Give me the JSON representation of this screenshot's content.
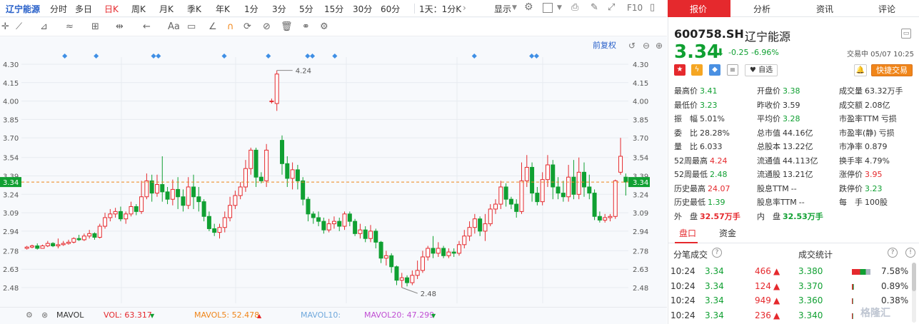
{
  "period_bar": {
    "stock": "辽宁能源",
    "items": [
      "分时",
      "多日",
      "日K",
      "周K",
      "月K",
      "季K",
      "年K",
      "1分",
      "3分",
      "5分",
      "15分",
      "30分",
      "60分",
      "1天：1分K"
    ],
    "active": "日K",
    "display": "显示",
    "f10": "F10"
  },
  "draw_bar": {
    "text_tool": "Aa",
    "fq": "前复权"
  },
  "chart": {
    "price_labels": [
      "4.30",
      "4.15",
      "4.00",
      "3.85",
      "3.70",
      "3.54",
      "3.39",
      "3.24",
      "3.09",
      "2.94",
      "2.78",
      "2.63",
      "2.48"
    ],
    "price_values": [
      4.3,
      4.15,
      4.0,
      3.85,
      3.7,
      3.54,
      3.39,
      3.24,
      3.09,
      2.94,
      2.78,
      2.63,
      2.48
    ],
    "current_label": "3.34",
    "current_value": 3.34,
    "high_label": "4.24",
    "low_label": "2.48",
    "up_color": "#e5292d",
    "down_color": "#10a032",
    "candles": [
      [
        2.8,
        2.81,
        2.79,
        2.82
      ],
      [
        2.81,
        2.82,
        2.8,
        2.83
      ],
      [
        2.82,
        2.8,
        2.79,
        2.84
      ],
      [
        2.8,
        2.82,
        2.8,
        2.83
      ],
      [
        2.82,
        2.84,
        2.81,
        2.86
      ],
      [
        2.84,
        2.82,
        2.81,
        2.85
      ],
      [
        2.82,
        2.83,
        2.8,
        2.88
      ],
      [
        2.83,
        2.84,
        2.82,
        2.86
      ],
      [
        2.84,
        2.85,
        2.83,
        2.87
      ],
      [
        2.85,
        2.88,
        2.84,
        2.89
      ],
      [
        2.88,
        2.87,
        2.86,
        2.91
      ],
      [
        2.87,
        2.9,
        2.86,
        2.92
      ],
      [
        2.9,
        2.92,
        2.88,
        2.95
      ],
      [
        2.92,
        2.89,
        2.87,
        2.93
      ],
      [
        2.89,
        2.98,
        2.88,
        3.0
      ],
      [
        2.98,
        3.05,
        2.96,
        3.09
      ],
      [
        3.05,
        3.08,
        3.02,
        3.12
      ],
      [
        3.08,
        3.1,
        3.05,
        3.13
      ],
      [
        3.1,
        3.04,
        3.02,
        3.14
      ],
      [
        3.04,
        3.08,
        3.0,
        3.1
      ],
      [
        3.08,
        3.14,
        3.06,
        3.18
      ],
      [
        3.14,
        3.1,
        3.07,
        3.16
      ],
      [
        3.1,
        3.22,
        3.08,
        3.35
      ],
      [
        3.22,
        3.35,
        3.2,
        3.41
      ],
      [
        3.35,
        3.25,
        3.18,
        3.4
      ],
      [
        3.25,
        3.32,
        3.22,
        3.4
      ],
      [
        3.32,
        3.26,
        3.18,
        3.55
      ],
      [
        3.26,
        3.2,
        3.16,
        3.3
      ],
      [
        3.2,
        3.28,
        3.15,
        3.36
      ],
      [
        3.28,
        3.22,
        3.12,
        3.38
      ],
      [
        3.22,
        3.15,
        3.1,
        3.28
      ],
      [
        3.15,
        3.3,
        3.12,
        3.38
      ],
      [
        3.3,
        3.22,
        3.12,
        3.4
      ],
      [
        3.22,
        3.18,
        3.1,
        3.3
      ],
      [
        3.18,
        3.06,
        3.02,
        3.2
      ],
      [
        3.06,
        2.96,
        2.94,
        3.1
      ],
      [
        2.96,
        2.93,
        2.9,
        3.0
      ],
      [
        2.93,
        2.97,
        2.88,
        3.0
      ],
      [
        2.97,
        3.05,
        2.93,
        3.1
      ],
      [
        3.05,
        3.15,
        3.02,
        3.22
      ],
      [
        3.15,
        3.23,
        3.12,
        3.27
      ],
      [
        3.23,
        3.3,
        3.2,
        3.34
      ],
      [
        3.3,
        3.45,
        3.26,
        3.52
      ],
      [
        3.45,
        3.6,
        3.4,
        3.62
      ],
      [
        3.6,
        3.38,
        3.3,
        3.62
      ],
      [
        3.38,
        3.35,
        3.33,
        3.42
      ],
      [
        3.35,
        3.6,
        3.3,
        3.65
      ],
      [
        4.0,
        4.0,
        3.98,
        4.02
      ],
      [
        3.98,
        4.22,
        3.92,
        4.25
      ],
      [
        3.68,
        3.49,
        3.4,
        3.72
      ],
      [
        3.49,
        3.37,
        3.3,
        3.55
      ],
      [
        3.37,
        3.44,
        3.28,
        3.5
      ],
      [
        3.44,
        3.35,
        3.28,
        3.48
      ],
      [
        3.35,
        3.2,
        3.15,
        3.38
      ],
      [
        3.2,
        3.08,
        3.02,
        3.22
      ],
      [
        3.08,
        3.05,
        3.0,
        3.1
      ],
      [
        3.05,
        3.02,
        2.98,
        3.1
      ],
      [
        3.02,
        2.95,
        2.92,
        3.05
      ],
      [
        2.95,
        3.0,
        2.93,
        3.04
      ],
      [
        3.0,
        3.02,
        2.96,
        3.06
      ],
      [
        3.02,
        2.98,
        2.94,
        3.05
      ],
      [
        2.98,
        3.08,
        2.95,
        3.1
      ],
      [
        3.08,
        3.02,
        2.98,
        3.1
      ],
      [
        3.02,
        2.92,
        2.9,
        3.04
      ],
      [
        2.92,
        2.95,
        2.88,
        3.0
      ],
      [
        2.95,
        2.88,
        2.85,
        2.98
      ],
      [
        2.88,
        2.94,
        2.85,
        2.99
      ],
      [
        2.94,
        2.85,
        2.8,
        2.96
      ],
      [
        2.85,
        2.72,
        2.68,
        2.86
      ],
      [
        2.72,
        2.74,
        2.66,
        2.78
      ],
      [
        2.74,
        2.65,
        2.6,
        2.76
      ],
      [
        2.65,
        2.54,
        2.5,
        2.66
      ],
      [
        2.54,
        2.56,
        2.48,
        2.6
      ],
      [
        2.56,
        2.52,
        2.49,
        2.58
      ],
      [
        2.52,
        2.58,
        2.5,
        2.62
      ],
      [
        2.58,
        2.62,
        2.55,
        2.7
      ],
      [
        2.62,
        2.73,
        2.6,
        2.78
      ],
      [
        2.73,
        2.8,
        2.7,
        2.82
      ],
      [
        2.8,
        2.76,
        2.72,
        2.9
      ],
      [
        2.76,
        2.8,
        2.73,
        2.85
      ],
      [
        2.8,
        2.74,
        2.72,
        2.82
      ],
      [
        2.74,
        2.77,
        2.72,
        2.8
      ],
      [
        2.77,
        2.76,
        2.73,
        2.8
      ],
      [
        2.76,
        2.83,
        2.74,
        2.86
      ],
      [
        2.83,
        2.9,
        2.8,
        2.95
      ],
      [
        2.9,
        2.97,
        2.86,
        3.02
      ],
      [
        2.97,
        3.04,
        2.92,
        3.08
      ],
      [
        3.04,
        2.94,
        2.9,
        3.06
      ],
      [
        2.94,
        3.0,
        2.86,
        3.08
      ],
      [
        3.0,
        3.12,
        2.98,
        3.16
      ],
      [
        3.12,
        3.16,
        3.08,
        3.2
      ],
      [
        3.16,
        3.3,
        3.12,
        3.35
      ],
      [
        3.3,
        3.2,
        3.14,
        3.33
      ],
      [
        3.2,
        3.16,
        3.12,
        3.22
      ],
      [
        3.16,
        3.1,
        3.05,
        3.2
      ],
      [
        3.1,
        3.35,
        3.08,
        3.5
      ],
      [
        3.35,
        3.46,
        3.3,
        3.56
      ],
      [
        3.46,
        3.25,
        3.18,
        3.5
      ],
      [
        3.25,
        3.18,
        3.15,
        3.3
      ],
      [
        3.18,
        3.36,
        3.15,
        3.42
      ],
      [
        3.36,
        3.48,
        3.3,
        3.56
      ],
      [
        3.48,
        3.3,
        3.2,
        3.52
      ],
      [
        3.3,
        3.25,
        3.2,
        3.38
      ],
      [
        3.25,
        3.22,
        3.18,
        3.35
      ],
      [
        3.22,
        3.38,
        3.18,
        3.48
      ],
      [
        3.38,
        3.24,
        3.2,
        3.52
      ],
      [
        3.24,
        3.42,
        3.2,
        3.54
      ],
      [
        3.42,
        3.3,
        3.22,
        3.5
      ],
      [
        3.3,
        3.25,
        3.2,
        3.4
      ],
      [
        3.25,
        3.06,
        3.03,
        3.28
      ],
      [
        3.06,
        3.03,
        3.01,
        3.1
      ],
      [
        3.03,
        3.05,
        3.01,
        3.08
      ],
      [
        3.05,
        3.06,
        3.02,
        3.08
      ],
      [
        3.06,
        3.35,
        3.04,
        3.36
      ],
      [
        3.42,
        3.55,
        3.4,
        3.7
      ],
      [
        3.38,
        3.34,
        3.23,
        3.41
      ]
    ],
    "markers": [
      0.067,
      0.119,
      0.214,
      0.222,
      0.331,
      0.404,
      0.469,
      0.477,
      0.514,
      0.745,
      0.84,
      0.848
    ]
  },
  "volume_bar": {
    "title": "MAVOL",
    "vol": "VOL: 63.317",
    "ma5": "MAVOL5: 52.478",
    "ma10": "MAVOL10:",
    "ma20": "MAVOL20: 47.299"
  },
  "tabs": [
    "报价",
    "分析",
    "资讯",
    "评论"
  ],
  "quote": {
    "code": "600758.SH",
    "name": "辽宁能源",
    "price": "3.34",
    "change": "-0.25",
    "pct": "-6.96%",
    "time": "交易中 05/07 10:25",
    "fav": "自选",
    "trade": "快捷交易"
  },
  "stats": [
    [
      [
        "最高价",
        "3.41",
        "g"
      ],
      [
        "开盘价",
        "3.38",
        "g"
      ],
      [
        "成交量",
        "63.32万手",
        "d"
      ]
    ],
    [
      [
        "最低价",
        "3.23",
        "g"
      ],
      [
        "昨收价",
        "3.59",
        "d"
      ],
      [
        "成交额",
        "2.08亿",
        "d"
      ]
    ],
    [
      [
        "振　幅",
        "5.01%",
        "d"
      ],
      [
        "平均价",
        "3.28",
        "g"
      ],
      [
        "市盈率TTM",
        "亏损",
        "d"
      ]
    ],
    [
      [
        "委　比",
        "28.28%",
        "d"
      ],
      [
        "总市值",
        "44.16亿",
        "d"
      ],
      [
        "市盈率(静)",
        "亏损",
        "d"
      ]
    ],
    [
      [
        "量　比",
        "6.033",
        "d"
      ],
      [
        "总股本",
        "13.22亿",
        "d"
      ],
      [
        "市净率",
        "0.879",
        "d"
      ]
    ],
    [
      [
        "52周最高",
        "4.24",
        "r"
      ],
      [
        "流通值",
        "44.113亿",
        "d"
      ],
      [
        "换手率",
        "4.79%",
        "d"
      ]
    ],
    [
      [
        "52周最低",
        "2.48",
        "g"
      ],
      [
        "流通股",
        "13.21亿",
        "d"
      ],
      [
        "涨停价",
        "3.95",
        "r"
      ]
    ],
    [
      [
        "历史最高",
        "24.07",
        "r"
      ],
      [
        "股息TTM",
        "--",
        "d"
      ],
      [
        "跌停价",
        "3.23",
        "g"
      ]
    ],
    [
      [
        "历史最低",
        "1.39",
        "g"
      ],
      [
        "股息率TTM",
        "--",
        "d"
      ],
      [
        "每　手",
        "100股",
        "d"
      ]
    ],
    [
      [
        "外　盘",
        "32.57万手",
        "r"
      ],
      [
        "内　盘",
        "32.53万手",
        "g"
      ],
      [
        "",
        "",
        ""
      ]
    ]
  ],
  "subtabs": [
    "盘口",
    "资金"
  ],
  "trades_title": "分笔成交",
  "stats_title": "成交统计",
  "trades": [
    [
      "10:24",
      "3.34",
      "466"
    ],
    [
      "10:24",
      "3.34",
      "124"
    ],
    [
      "10:24",
      "3.34",
      "949"
    ],
    [
      "10:24",
      "3.34",
      "236"
    ]
  ],
  "dist": [
    [
      "3.380",
      "7.58%"
    ],
    [
      "3.370",
      "0.89%"
    ],
    [
      "3.360",
      "0.38%"
    ],
    [
      "3.340",
      ""
    ]
  ],
  "watermark": "格隆汇"
}
